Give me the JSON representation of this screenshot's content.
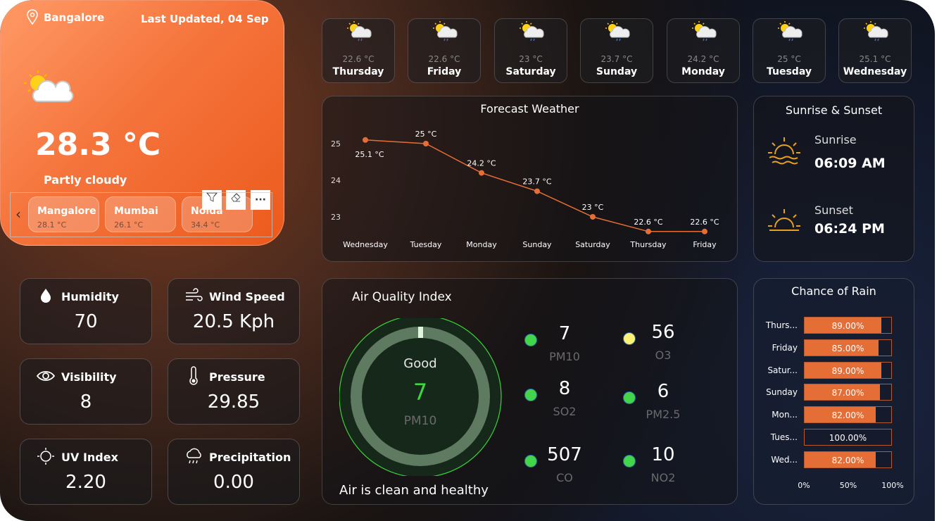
{
  "current": {
    "city": "Bangalore",
    "last_updated": "Last Updated, 04 Sep",
    "temperature": "28.3 °C",
    "condition": "Partly cloudy",
    "icon": "partly-cloudy-icon"
  },
  "cities": [
    {
      "name": "Mangalore",
      "temp": "28.1 °C"
    },
    {
      "name": "Mumbai",
      "temp": "26.1 °C"
    },
    {
      "name": "Noida",
      "temp": "34.4 °C"
    }
  ],
  "toolbar": {
    "more": "···"
  },
  "days": [
    {
      "name": "Thursday",
      "temp": "22.6 °C"
    },
    {
      "name": "Friday",
      "temp": "22.6 °C"
    },
    {
      "name": "Saturday",
      "temp": "23 °C"
    },
    {
      "name": "Sunday",
      "temp": "23.7 °C"
    },
    {
      "name": "Monday",
      "temp": "24.2 °C"
    },
    {
      "name": "Tuesday",
      "temp": "25 °C"
    },
    {
      "name": "Wednesday",
      "temp": "25.1 °C"
    }
  ],
  "stats": {
    "humidity": {
      "label": "Humidity",
      "value": "70"
    },
    "wind": {
      "label": "Wind Speed",
      "value": "20.5 Kph"
    },
    "visibility": {
      "label": "Visibility",
      "value": "8"
    },
    "pressure": {
      "label": "Pressure",
      "value": "29.85"
    },
    "uv": {
      "label": "UV Index",
      "value": "2.20"
    },
    "precip": {
      "label": "Precipitation",
      "value": "0.00"
    }
  },
  "sun": {
    "title": "Sunrise & Sunset",
    "sunrise_label": "Sunrise",
    "sunrise": "06:09 AM",
    "sunset_label": "Sunset",
    "sunset": "06:24 PM"
  },
  "aqi": {
    "title": "Air Quality Index",
    "status": "Good",
    "value": "7",
    "pollutant": "PM10",
    "message": "Air is clean and healthy",
    "items": [
      {
        "value": "7",
        "label": "PM10",
        "color": "#44d64a"
      },
      {
        "value": "56",
        "label": "O3",
        "color": "#fff176"
      },
      {
        "value": "8",
        "label": "SO2",
        "color": "#44d64a"
      },
      {
        "value": "6",
        "label": "PM2.5",
        "color": "#44d64a"
      },
      {
        "value": "507",
        "label": "CO",
        "color": "#44d64a"
      },
      {
        "value": "10",
        "label": "NO2",
        "color": "#44d64a"
      }
    ]
  },
  "chart_data": [
    {
      "type": "line",
      "title": "Forecast Weather",
      "categories": [
        "Wednesday",
        "Tuesday",
        "Monday",
        "Sunday",
        "Saturday",
        "Thursday",
        "Friday"
      ],
      "values": [
        25.1,
        25,
        24.2,
        23.7,
        23,
        22.6,
        22.6
      ],
      "labels": [
        "25.1 °C",
        "25 °C",
        "24.2 °C",
        "23.7 °C",
        "23 °C",
        "22.6 °C",
        "22.6 °C"
      ],
      "yticks": [
        "23",
        "24",
        "25"
      ],
      "ylim": [
        22.5,
        25.3
      ],
      "color": "#e56e37"
    },
    {
      "type": "bar",
      "title": "Chance of Rain",
      "categories": [
        "Thurs...",
        "Friday",
        "Satur...",
        "Sunday",
        "Mon...",
        "Tues...",
        "Wed..."
      ],
      "values": [
        89,
        85,
        89,
        87,
        82,
        100,
        82
      ],
      "labels": [
        "89.00%",
        "85.00%",
        "89.00%",
        "87.00%",
        "82.00%",
        "100.00%",
        "82.00%"
      ],
      "xticks": [
        "0%",
        "50%",
        "100%"
      ],
      "xlim": [
        0,
        100
      ],
      "color": "#e56e37"
    }
  ]
}
